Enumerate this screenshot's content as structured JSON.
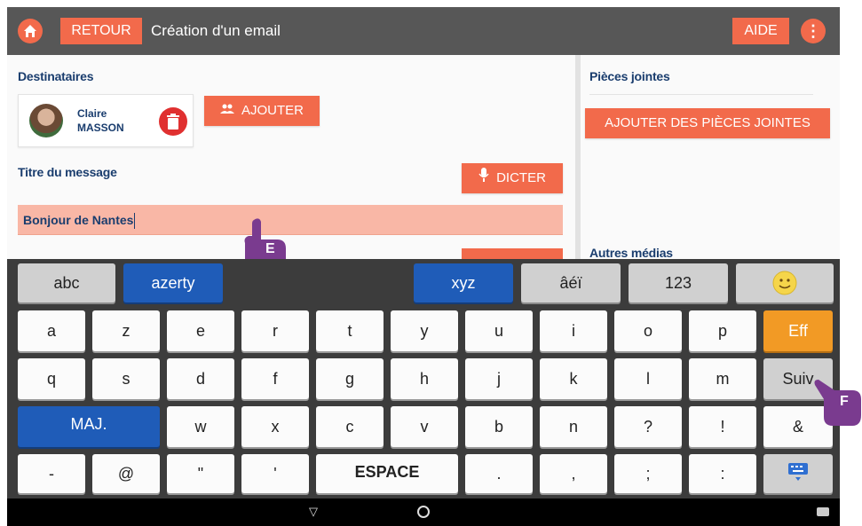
{
  "header": {
    "home_icon": "home-icon",
    "back_label": "RETOUR",
    "title": "Création d'un email",
    "help_label": "AIDE",
    "more_icon": "more-vertical-icon",
    "accent_color": "#f26a4b",
    "bar_color": "#575757"
  },
  "recipients": {
    "label": "Destinataires",
    "contact": {
      "first_name": "Claire",
      "last_name": "MASSON"
    },
    "delete_icon": "trash-icon",
    "add_label": "AJOUTER",
    "add_icon": "people-icon"
  },
  "message": {
    "title_label": "Titre du message",
    "dictate_label": "DICTER",
    "dictate_icon": "microphone-icon",
    "title_value": "Bonjour de Nantes"
  },
  "attachments": {
    "label": "Pièces jointes",
    "add_label": "AJOUTER DES PIÈCES JOINTES",
    "other_media_label": "Autres médias"
  },
  "markers": {
    "e_label": "E",
    "f_label": "F",
    "color": "#7a3b8f"
  },
  "keyboard": {
    "mode_row": [
      {
        "label": "abc",
        "style": "gray"
      },
      {
        "label": "azerty",
        "style": "blue"
      },
      {
        "label": "xyz",
        "style": "blue"
      },
      {
        "label": "âéï",
        "style": "gray"
      },
      {
        "label": "123",
        "style": "gray"
      },
      {
        "label": "emoji",
        "style": "gray",
        "icon": "smiley-icon"
      }
    ],
    "row1": [
      "a",
      "z",
      "e",
      "r",
      "t",
      "y",
      "u",
      "i",
      "o",
      "p",
      "Eff"
    ],
    "row2": [
      "q",
      "s",
      "d",
      "f",
      "g",
      "h",
      "j",
      "k",
      "l",
      "m",
      "Suiv"
    ],
    "row3": [
      "MAJ.",
      "w",
      "x",
      "c",
      "v",
      "b",
      "n",
      "?",
      "!",
      "&"
    ],
    "row4": [
      "-",
      "@",
      "\"",
      "'",
      "ESPACE",
      ".",
      ",",
      ";",
      ":",
      "keyboard-hide-icon"
    ]
  },
  "navbar": {
    "back_icon": "nav-back-icon",
    "home_icon": "nav-home-icon",
    "keyboard_icon": "keyboard-icon"
  }
}
